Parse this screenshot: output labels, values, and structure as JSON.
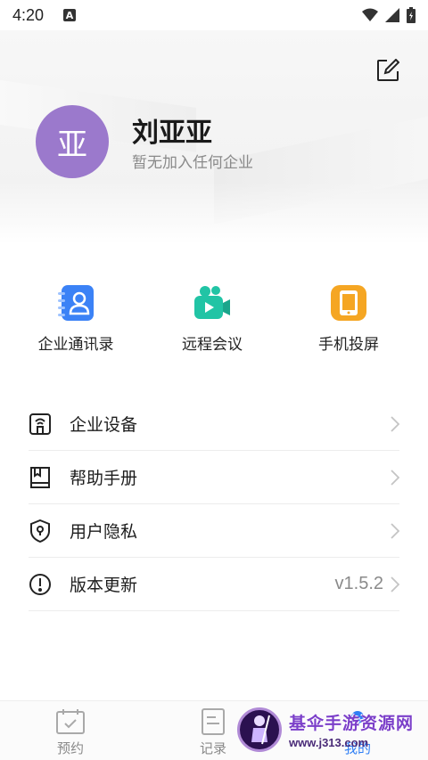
{
  "status_bar": {
    "time": "4:20",
    "notification_letter": "A"
  },
  "profile": {
    "avatar_text": "亚",
    "name": "刘亚亚",
    "subtitle": "暂无加入任何企业"
  },
  "quick_actions": [
    {
      "label": "企业通讯录",
      "icon": "contacts-book-icon",
      "color": "#3b82f6"
    },
    {
      "label": "远程会议",
      "icon": "video-camera-icon",
      "color": "#21c4a5"
    },
    {
      "label": "手机投屏",
      "icon": "phone-cast-icon",
      "color": "#f5a623"
    }
  ],
  "menu": [
    {
      "label": "企业设备",
      "icon": "device-icon",
      "value": ""
    },
    {
      "label": "帮助手册",
      "icon": "book-icon",
      "value": ""
    },
    {
      "label": "用户隐私",
      "icon": "shield-location-icon",
      "value": ""
    },
    {
      "label": "版本更新",
      "icon": "info-circle-icon",
      "value": "v1.5.2"
    }
  ],
  "tabs": [
    {
      "label": "预约",
      "icon": "calendar-icon"
    },
    {
      "label": "记录",
      "icon": "document-icon"
    },
    {
      "label": "我的",
      "icon": "user-icon"
    }
  ],
  "watermark": {
    "title": "基伞手游资源网",
    "url": "www.j313.com"
  },
  "colors": {
    "accent": "#2f7ff5",
    "avatar": "#9b79cc"
  }
}
